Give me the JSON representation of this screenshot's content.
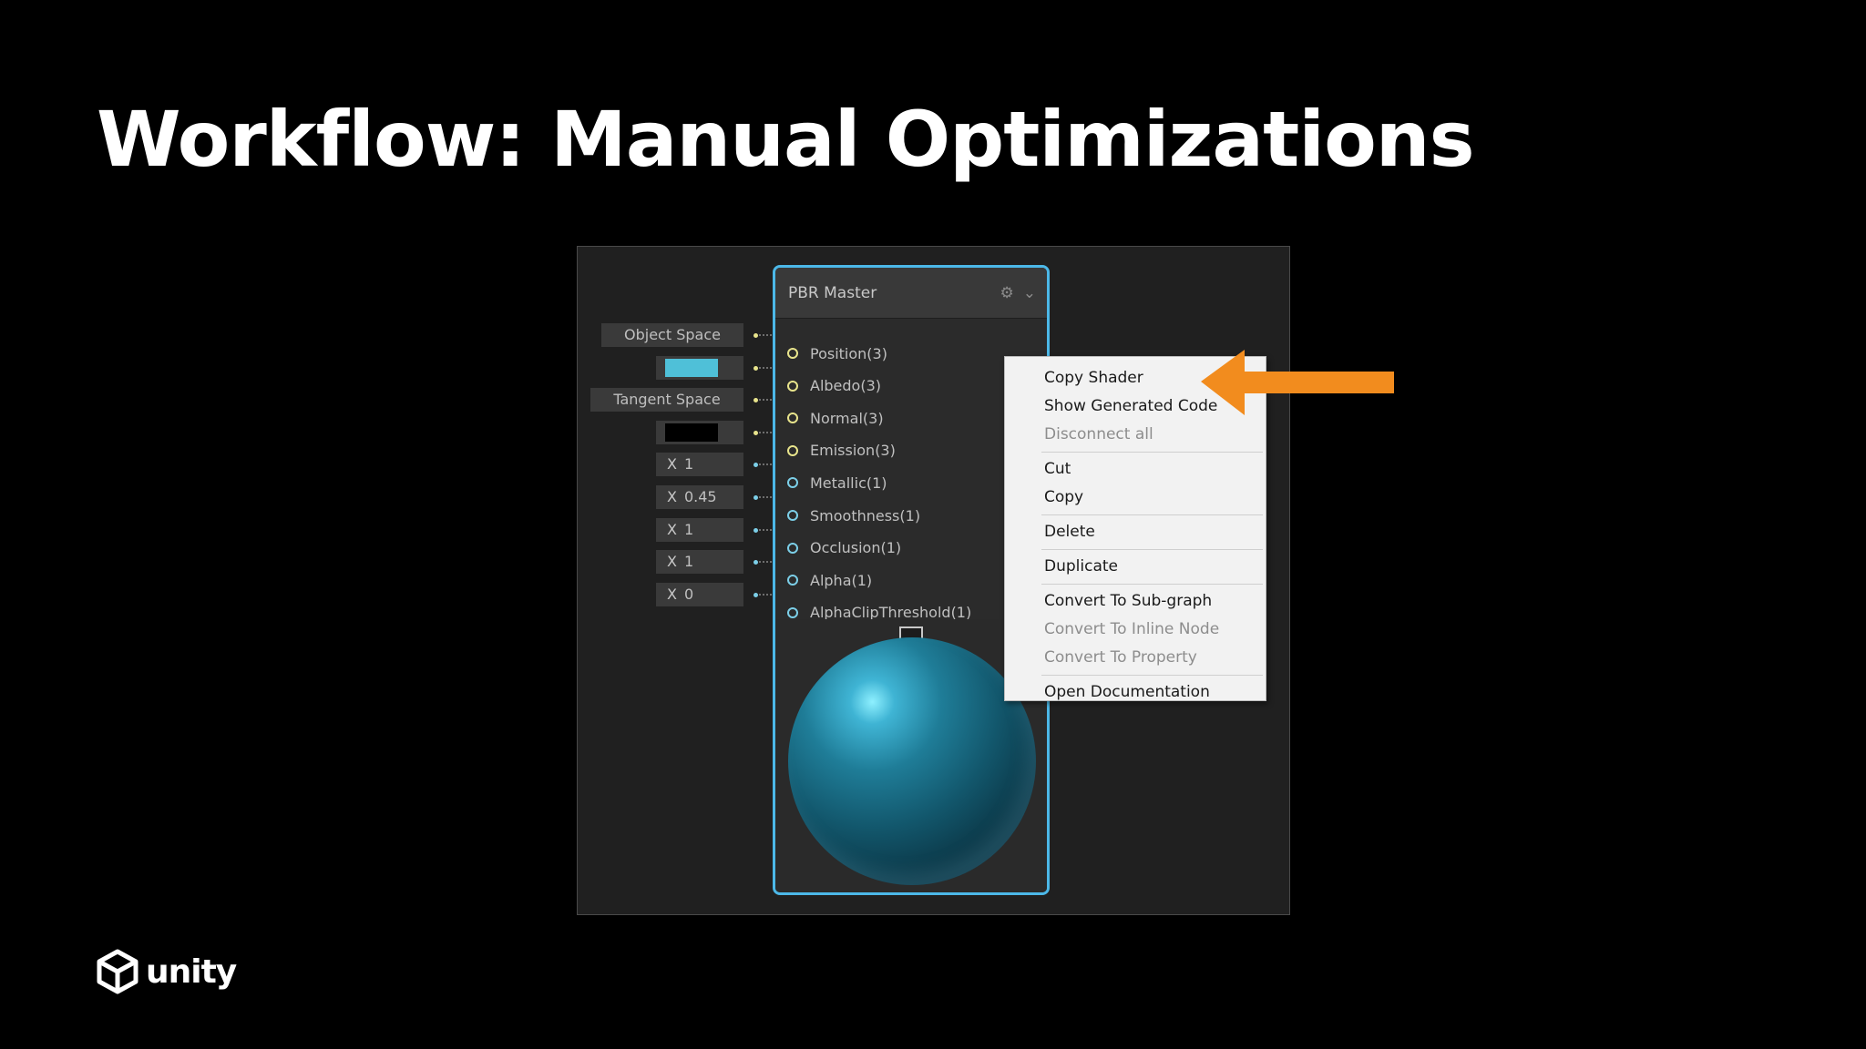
{
  "slide": {
    "title": "Workflow: Manual Optimizations"
  },
  "inputs": [
    {
      "kind": "enum",
      "label": "Object Space"
    },
    {
      "kind": "color",
      "color": "#4fc0d8"
    },
    {
      "kind": "enum",
      "label": "Tangent Space"
    },
    {
      "kind": "color",
      "color": "#000000"
    },
    {
      "kind": "number",
      "axis": "X",
      "value": "1"
    },
    {
      "kind": "number",
      "axis": "X",
      "value": "0.45"
    },
    {
      "kind": "number",
      "axis": "X",
      "value": "1"
    },
    {
      "kind": "number",
      "axis": "X",
      "value": "1"
    },
    {
      "kind": "number",
      "axis": "X",
      "value": "0"
    }
  ],
  "node": {
    "title": "PBR Master",
    "header_icons": [
      "gear-icon",
      "chevron-down-icon"
    ],
    "slots": [
      {
        "label": "Position(3)",
        "color": "#e8e48c"
      },
      {
        "label": "Albedo(3)",
        "color": "#e8e48c"
      },
      {
        "label": "Normal(3)",
        "color": "#e8e48c"
      },
      {
        "label": "Emission(3)",
        "color": "#e8e48c"
      },
      {
        "label": "Metallic(1)",
        "color": "#7ccfe8"
      },
      {
        "label": "Smoothness(1)",
        "color": "#7ccfe8"
      },
      {
        "label": "Occlusion(1)",
        "color": "#7ccfe8"
      },
      {
        "label": "Alpha(1)",
        "color": "#7ccfe8"
      },
      {
        "label": "AlphaClipThreshold(1)",
        "color": "#7ccfe8"
      }
    ]
  },
  "context_menu": {
    "groups": [
      [
        {
          "label": "Copy Shader",
          "enabled": true
        },
        {
          "label": "Show Generated Code",
          "enabled": true
        },
        {
          "label": "Disconnect all",
          "enabled": false
        }
      ],
      [
        {
          "label": "Cut",
          "enabled": true
        },
        {
          "label": "Copy",
          "enabled": true
        }
      ],
      [
        {
          "label": "Delete",
          "enabled": true
        }
      ],
      [
        {
          "label": "Duplicate",
          "enabled": true
        }
      ],
      [
        {
          "label": "Convert To Sub-graph",
          "enabled": true
        },
        {
          "label": "Convert To Inline Node",
          "enabled": false
        },
        {
          "label": "Convert To Property",
          "enabled": false
        }
      ],
      [
        {
          "label": "Open Documentation",
          "enabled": true
        }
      ]
    ]
  },
  "arrow": {
    "color": "#f28c1e"
  },
  "brand": {
    "name": "unity"
  }
}
